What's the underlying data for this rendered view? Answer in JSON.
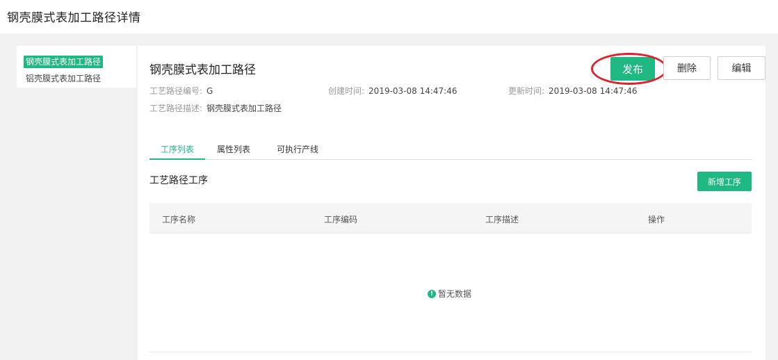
{
  "page": {
    "title": "钢壳膜式表加工路径详情"
  },
  "sidebar": {
    "items": [
      {
        "label": "钢壳膜式表加工路径",
        "active": true
      },
      {
        "label": "铝壳膜式表加工路径",
        "active": false
      }
    ]
  },
  "detail": {
    "title": "钢壳膜式表加工路径",
    "code_label": "工艺路径编号:",
    "code_value": "G",
    "created_label": "创建时间:",
    "created_value": "2019-03-08 14:47:46",
    "updated_label": "更新时间:",
    "updated_value": "2019-03-08 14:47:46",
    "desc_label": "工艺路径描述:",
    "desc_value": "钢壳膜式表加工路径"
  },
  "actions": {
    "publish": "发布",
    "delete": "删除",
    "edit": "编辑"
  },
  "tabs": [
    {
      "label": "工序列表",
      "active": true
    },
    {
      "label": "属性列表",
      "active": false
    },
    {
      "label": "可执行产线",
      "active": false
    }
  ],
  "section": {
    "title": "工艺路径工序",
    "add_button": "新增工序"
  },
  "table": {
    "columns": [
      "工序名称",
      "工序编码",
      "工序描述",
      "操作"
    ],
    "rows": [],
    "empty_text": "暂无数据",
    "empty_icon": "info-icon"
  },
  "colors": {
    "accent": "#1fb882",
    "highlight_ring": "#e0202a"
  }
}
